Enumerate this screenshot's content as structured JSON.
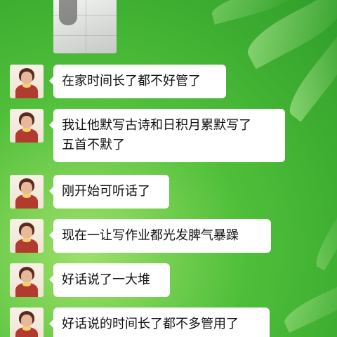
{
  "messages": [
    {
      "lines": [
        "在家时间长了都不好管了"
      ]
    },
    {
      "lines": [
        "我让他默写古诗和日积月累默写了",
        "五首不默了"
      ]
    },
    {
      "lines": [
        "刚开始可听话了"
      ]
    },
    {
      "lines": [
        "现在一让写作业都光发脾气暴躁"
      ]
    },
    {
      "lines": [
        "好话说了一大堆"
      ]
    },
    {
      "lines": [
        "好话说的时间长了都不多管用了"
      ]
    }
  ],
  "colors": {
    "background": "#4fbf3a",
    "bubble": "#ffffff",
    "text": "#111111"
  }
}
